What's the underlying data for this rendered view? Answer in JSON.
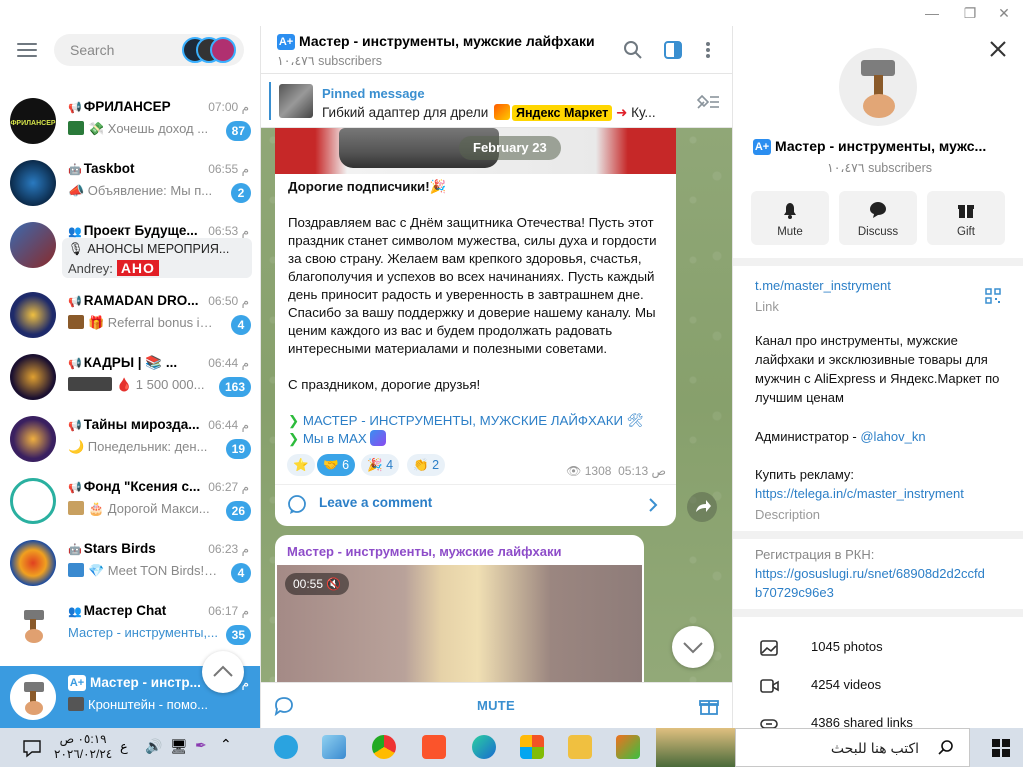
{
  "sidebar": {
    "search_placeholder": "Search",
    "chats": [
      {
        "name": "ФРИЛАНСЕР",
        "time": "07:00 م",
        "preview": "💸 Хочешь доход ...",
        "badge": "87",
        "color": "#111"
      },
      {
        "name": "Taskbot",
        "time": "06:55 م",
        "preview": "📣 Объявление:  Мы п...",
        "badge": "2",
        "color": "#0b2a4a"
      },
      {
        "name": "Проект Будуще...",
        "time": "06:53 م",
        "preview_line1": "🎙 АНОНСЫ МЕРОПРИЯ...",
        "preview_line2": "Andrey:",
        "preview_tag": "АНО",
        "color": "#2a4a7a"
      },
      {
        "name": "RAMADAN DRO...",
        "time": "06:50 م",
        "preview": "🎁 Referral bonus is ...",
        "badge": "4",
        "color": "#1e2a6a"
      },
      {
        "name": "КАДРЫ | 📚 ...",
        "time": "06:44 م",
        "preview": "🩸 1 500 000...",
        "badge": "163",
        "color": "#1b1030"
      },
      {
        "name": "Тайны мирозда...",
        "time": "06:44 م",
        "preview": "🌙 Понедельник: ден...",
        "badge": "19",
        "color": "#3a2060"
      },
      {
        "name": "Фонд \"Ксения с...",
        "time": "06:27 م",
        "preview": "🎂 Дорогой Макси...",
        "badge": "26",
        "color": "#2ab0a0"
      },
      {
        "name": "Stars Birds",
        "time": "06:23 م",
        "preview": "💎 Meet TON Birds! ...",
        "badge": "4",
        "color": "#1a4aa0"
      },
      {
        "name": "Мастер Chat",
        "time": "06:17 م",
        "preview": "Мастер - инструменты,...",
        "badge": "35",
        "color": "#fff"
      },
      {
        "name": "Мастер - инстр...",
        "time": "م",
        "preview": "Кронштейн - помо...",
        "badge": "",
        "color": "#fff"
      }
    ]
  },
  "channel": {
    "title": "Мастер - инструменты, мужские лайфхаки",
    "subscribers": "١٠،٤٧٦ subscribers",
    "pinned_title": "Pinned message",
    "pinned_text_a": "Гибкий адаптер для дрели",
    "pinned_ym": "Яндекс Маркет",
    "pinned_text_b": "Ку..."
  },
  "message1": {
    "date": "February 23",
    "heading": "Дорогие подписчики!",
    "p1": "Поздравляем вас с Днём защитника Отечества! Пусть этот праздник станет символом мужества, силы духа и гордости за свою страну. Желаем вам крепкого здоровья, счастья, благополучия и успехов во всех начинаниях. Пусть каждый день приносит радость и уверенность в завтрашнем дне. Спасибо за вашу поддержку и доверие нашему каналу. Мы ценим каждого из вас и будем продолжать радовать интересными материалами и полезными советами.",
    "p2": "С праздником, дорогие друзья!",
    "link1": "МАСТЕР - ИНСТРУМЕНТЫ, МУЖСКИЕ ЛАЙФХАКИ",
    "link2": "Мы в MAX",
    "reactions": [
      {
        "emoji": "⭐",
        "count": ""
      },
      {
        "emoji": "🤝",
        "count": "6"
      },
      {
        "emoji": "🎉",
        "count": "4"
      },
      {
        "emoji": "👏",
        "count": "2"
      }
    ],
    "views": "1308",
    "time": "05:13 ص",
    "leave_comment": "Leave a comment"
  },
  "message2": {
    "author": "Мастер - инструменты, мужские лайфхаки",
    "video_time": "00:55"
  },
  "footer": {
    "mute": "MUTE"
  },
  "info": {
    "title": "Мастер - инструменты, мужс...",
    "subscribers": "١٠،٤٧٦ subscribers",
    "actions": [
      {
        "label": "Mute",
        "icon": "bell-icon"
      },
      {
        "label": "Discuss",
        "icon": "chat-bubble-icon"
      },
      {
        "label": "Gift",
        "icon": "gift-icon"
      }
    ],
    "link": "t.me/master_instryment",
    "link_label": "Link",
    "desc_1": "Канал про инструменты, мужские лайфхаки и эксклюзивные товары для мужчин с AliExpress и Яндекс.Маркет по лучшим ценам",
    "desc_admin_prefix": "Администратор - ",
    "desc_admin": "@lahov_kn",
    "desc_buy": "Купить рекламу:",
    "desc_buy_link": "https://telega.in/c/master_instryment",
    "desc_label": "Description",
    "rkn_title": "Регистрация в РКН:",
    "rkn_link1": "https://gosuslugi.ru/snet/68908d2d2ccfd",
    "rkn_link2": "b70729c96e3",
    "media": [
      {
        "label": "1045 photos",
        "icon": "photo-icon"
      },
      {
        "label": "4254 videos",
        "icon": "video-icon"
      },
      {
        "label": "4386 shared links",
        "icon": "link-icon"
      }
    ]
  },
  "taskbar": {
    "search_text": "اكتب هنا للبحث",
    "time": "٠٥:١٩ ص",
    "date": "٢٠٢٦/٠٢/٢٤",
    "lang": "ع"
  }
}
